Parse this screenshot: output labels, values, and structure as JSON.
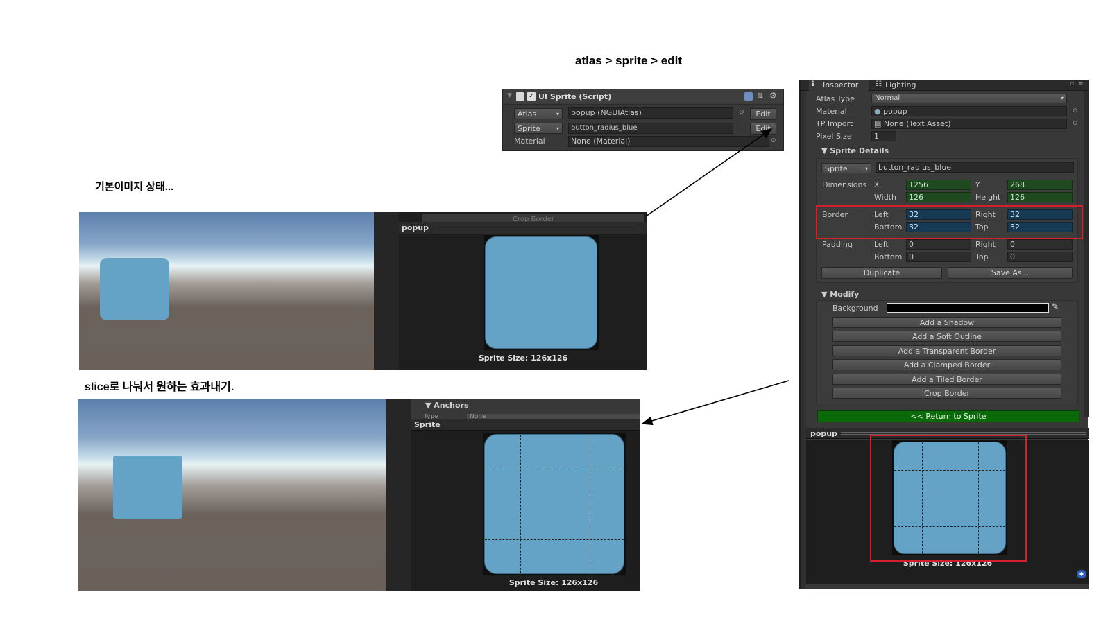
{
  "captions": {
    "path": "atlas > sprite > edit",
    "default_state": "기본이미지 상태...",
    "slice_effect": "slice로 나눠서 원하는 효과내기."
  },
  "script_panel": {
    "title": "UI Sprite (Script)",
    "atlas_label": "Atlas",
    "atlas_value": "popup (NGUIAtlas)",
    "sprite_label": "Sprite",
    "sprite_value": "button_radius_blue",
    "material_label": "Material",
    "material_value": "None (Material)",
    "edit_label": "Edit"
  },
  "preview_top": {
    "crop_border": "Crop Border",
    "header": "popup",
    "size_text": "Sprite Size: 126x126"
  },
  "preview_bottom": {
    "anchors": "▼ Anchors",
    "type_label": "Type",
    "type_value": "None",
    "header": "Sprite",
    "size_text": "Sprite Size: 126x126"
  },
  "inspector": {
    "tabs": [
      "Inspector",
      "Lighting"
    ],
    "atlas_type_label": "Atlas Type",
    "atlas_type_value": "Normal",
    "material_label": "Material",
    "material_value": "popup",
    "tp_import_label": "TP Import",
    "tp_import_value": "None (Text Asset)",
    "pixel_size_label": "Pixel Size",
    "pixel_size_value": "1",
    "sprite_details": "▼ Sprite Details",
    "sprite_drop": "Sprite",
    "sprite_name": "button_radius_blue",
    "dimensions_label": "Dimensions",
    "x_label": "X",
    "x_value": "1256",
    "y_label": "Y",
    "y_value": "268",
    "width_label": "Width",
    "width_value": "126",
    "height_label": "Height",
    "height_value": "126",
    "border_label": "Border",
    "left_label": "Left",
    "border_left": "32",
    "right_label": "Right",
    "border_right": "32",
    "bottom_label": "Bottom",
    "border_bottom": "32",
    "top_label": "Top",
    "border_top": "32",
    "padding_label": "Padding",
    "padding_left": "0",
    "padding_right": "0",
    "padding_bottom": "0",
    "padding_top": "0",
    "duplicate": "Duplicate",
    "save_as": "Save As...",
    "modify": "▼ Modify",
    "background_label": "Background",
    "modify_buttons": [
      "Add a Shadow",
      "Add a Soft Outline",
      "Add a Transparent Border",
      "Add a Clamped Border",
      "Add a Tiled Border",
      "Crop Border"
    ],
    "return_button": "<< Return to Sprite",
    "preview_header": "popup",
    "size_text": "Sprite Size: 126x126"
  },
  "colors": {
    "highlight": "#d4202a",
    "sprite_blue": "#64a3c6",
    "return_green": "#0a6a0a"
  }
}
